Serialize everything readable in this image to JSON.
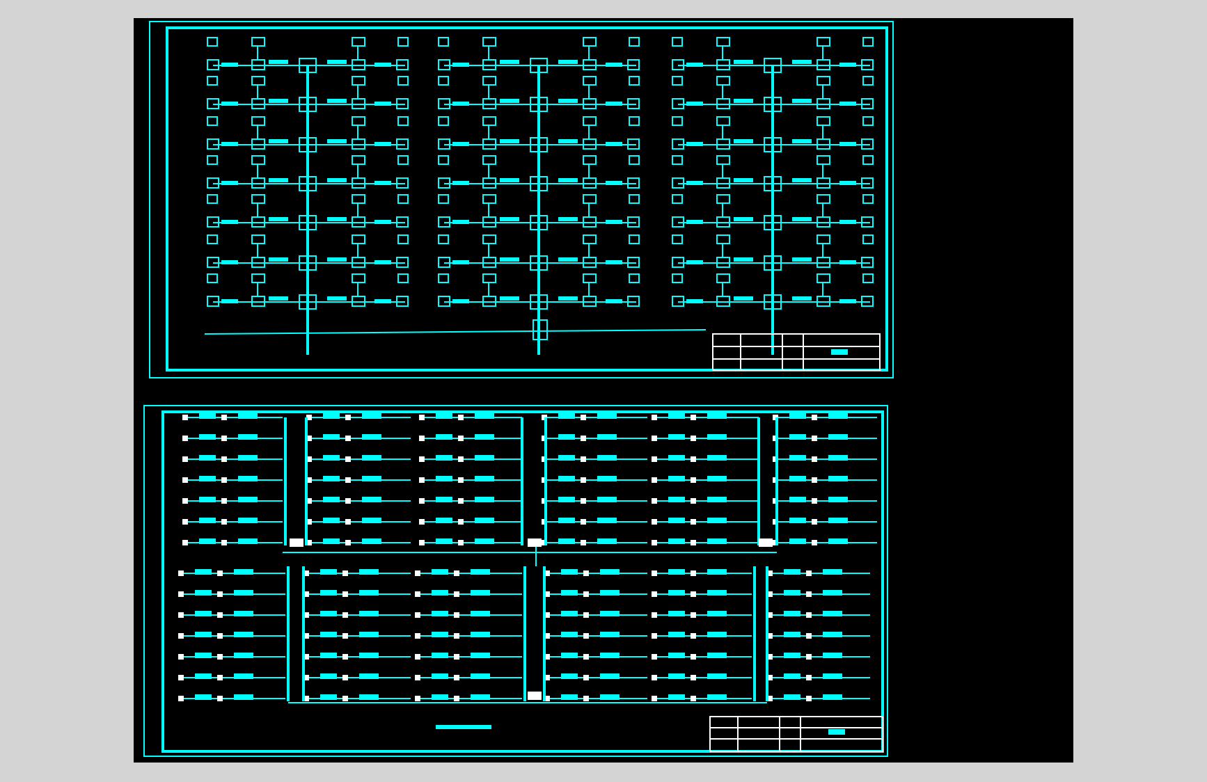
{
  "canvas": {
    "sheets": [
      {
        "kind": "riser"
      },
      {
        "kind": "wiring"
      }
    ]
  }
}
